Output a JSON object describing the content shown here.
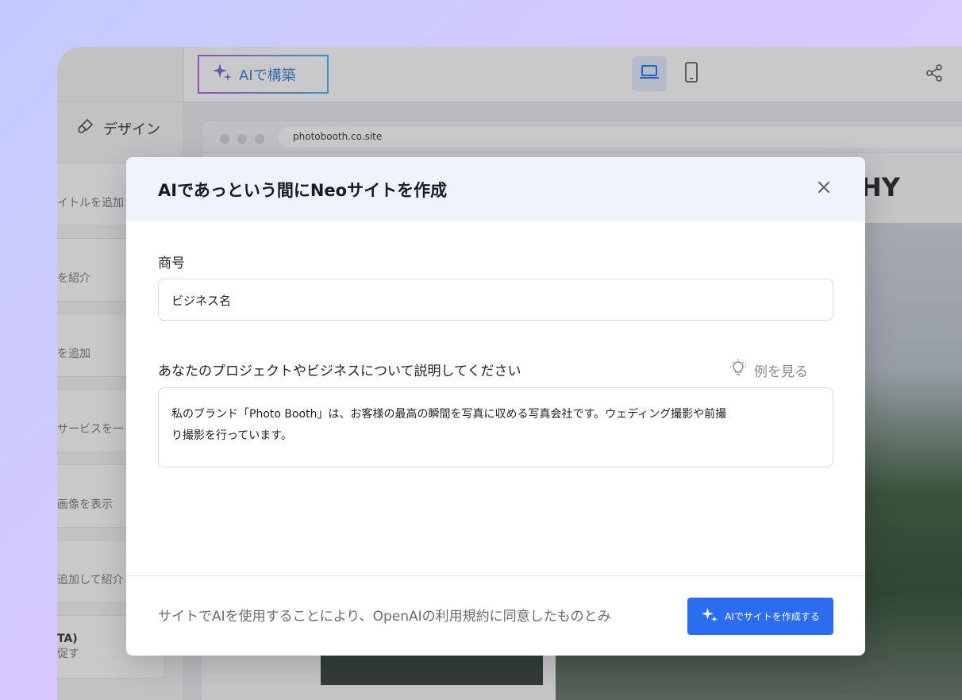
{
  "toolbar": {
    "ai_build_label": "AIで構築"
  },
  "sidebar": {
    "design_tab_label": "デザイン",
    "items": [
      {
        "label": "イトルを追加"
      },
      {
        "label": "を紹介"
      },
      {
        "label": "を追加"
      },
      {
        "label": "サービスを一"
      },
      {
        "label": "画像を表示"
      },
      {
        "label": "追加して紹介"
      },
      {
        "label": "TA)"
      }
    ],
    "partial_text": "促す"
  },
  "preview": {
    "url": "photobooth.co.site",
    "heading_fragment": "HY"
  },
  "modal": {
    "title": "AIであっという間にNeoサイトを作成",
    "business_label": "商号",
    "business_value": "ビジネス名",
    "description_label": "あなたのプロジェクトやビジネスについて説明してください",
    "examples_label": "例を見る",
    "description_line1": "私のブランド「Photo Booth」は、お客様の最高の瞬間を写真に収める写真会社です。ウェディング撮影や前撮",
    "description_line2": "り撮影を行っています。",
    "terms_text": "サイトでAIを使用することにより、OpenAIの利用規約に同意したものとみ",
    "create_button_label": "AIでサイトを作成する"
  },
  "colors": {
    "accent": "#2b6cf0",
    "header_bg": "#eff3fd"
  },
  "icons": [
    "sparkle-icon",
    "laptop-icon",
    "mobile-icon",
    "share-icon",
    "brush-icon",
    "close-icon",
    "lightbulb-icon"
  ]
}
